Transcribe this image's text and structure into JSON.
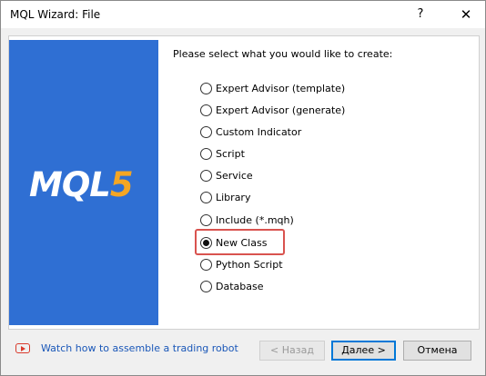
{
  "window": {
    "title": "MQL Wizard: File",
    "help_label": "?",
    "close_label": "✕"
  },
  "banner": {
    "logo_main": "MQL",
    "logo_digit": "5",
    "bg_color": "#2f6fd3",
    "accent_color": "#f5a623"
  },
  "prompt": "Please select what you would like to create:",
  "options": [
    {
      "label": "Expert Advisor (template)",
      "checked": false
    },
    {
      "label": "Expert Advisor (generate)",
      "checked": false
    },
    {
      "label": "Custom Indicator",
      "checked": false
    },
    {
      "label": "Script",
      "checked": false
    },
    {
      "label": "Service",
      "checked": false
    },
    {
      "label": "Library",
      "checked": false
    },
    {
      "label": "Include (*.mqh)",
      "checked": false
    },
    {
      "label": "New Class",
      "checked": true
    },
    {
      "label": "Python Script",
      "checked": false
    },
    {
      "label": "Database",
      "checked": false
    }
  ],
  "footer": {
    "video_icon": "youtube-icon",
    "link_text": "Watch how to assemble a trading robot",
    "back_label": "< Назад",
    "next_label": "Далее >",
    "cancel_label": "Отмена"
  }
}
